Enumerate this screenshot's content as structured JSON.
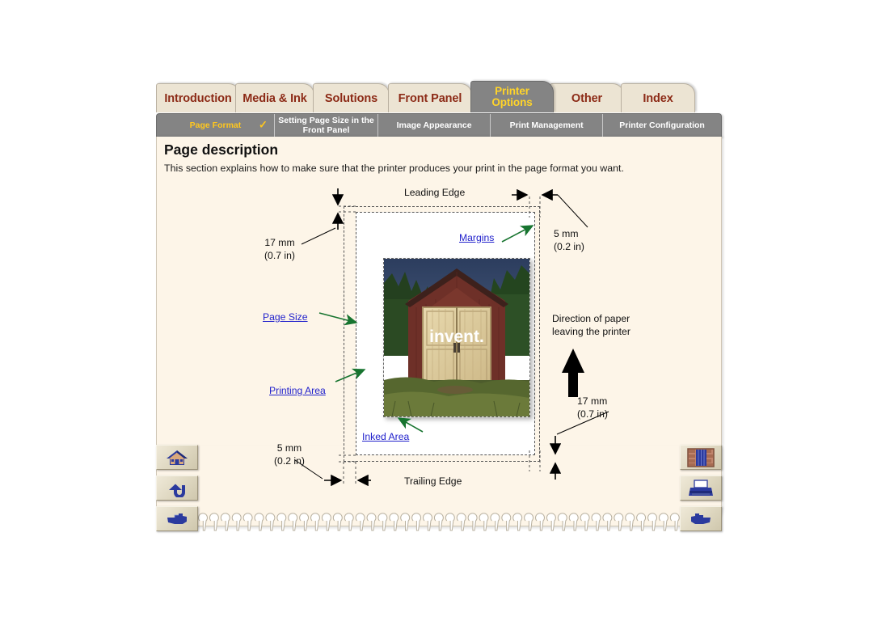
{
  "tabs": [
    {
      "label": "Introduction",
      "active": false,
      "name": "tab-introduction"
    },
    {
      "label": "Media & Ink",
      "active": false,
      "name": "tab-media-ink"
    },
    {
      "label": "Solutions",
      "active": false,
      "name": "tab-solutions"
    },
    {
      "label": "Front Panel",
      "active": false,
      "name": "tab-front-panel"
    },
    {
      "label": "Printer Options",
      "active": true,
      "name": "tab-printer-options"
    },
    {
      "label": "Other",
      "active": false,
      "name": "tab-other"
    },
    {
      "label": "Index",
      "active": false,
      "name": "tab-index"
    }
  ],
  "subtabs": [
    {
      "label": "Page Format",
      "active": true,
      "check": "✓"
    },
    {
      "label": "Setting Page Size in the Front Panel",
      "active": false,
      "check": ""
    },
    {
      "label": "Image Appearance",
      "active": false,
      "check": ""
    },
    {
      "label": "Print Management",
      "active": false,
      "check": ""
    },
    {
      "label": "Printer Configuration",
      "active": false,
      "check": ""
    }
  ],
  "content": {
    "title": "Page description",
    "intro": "This section explains how to make sure that the printer produces your print in the page format you want."
  },
  "diagram": {
    "leading_edge": "Leading Edge",
    "trailing_edge": "Trailing Edge",
    "margin_top_mm": "17 mm",
    "margin_top_in": "(0.7 in)",
    "margin_right_mm": "5 mm",
    "margin_right_in": "(0.2 in)",
    "margin_bottom_mm": "17 mm",
    "margin_bottom_in": "(0.7 in)",
    "margin_left_mm": "5 mm",
    "margin_left_in": "(0.2 in)",
    "direction_line1": "Direction of paper",
    "direction_line2": "leaving the printer",
    "link_margins": "Margins",
    "link_page_size": "Page Size",
    "link_printing_area": "Printing Area",
    "link_inked_area": "Inked Area",
    "photo_caption": "invent."
  },
  "nav": {
    "left": [
      {
        "name": "home-button",
        "icon": "home-icon",
        "label": "Home"
      },
      {
        "name": "back-button",
        "icon": "back-arrow-icon",
        "label": "Back"
      },
      {
        "name": "next-button",
        "icon": "pointing-hand-right-icon",
        "label": "Next"
      }
    ],
    "right": [
      {
        "name": "bookshelf-button",
        "icon": "bookshelf-icon",
        "label": "Bookshelf"
      },
      {
        "name": "print-button",
        "icon": "printer-icon",
        "label": "Print"
      },
      {
        "name": "previous-button",
        "icon": "pointing-hand-left-icon",
        "label": "Previous"
      }
    ]
  },
  "colors": {
    "tab_bg": "#ece4d3",
    "tab_text": "#8c2a16",
    "active_tab_bg": "#848484",
    "active_tab_text": "#ffd42a",
    "sheet_bg": "#fdf5e8",
    "link": "#2222cc",
    "arrow_green": "#1a7a33"
  }
}
